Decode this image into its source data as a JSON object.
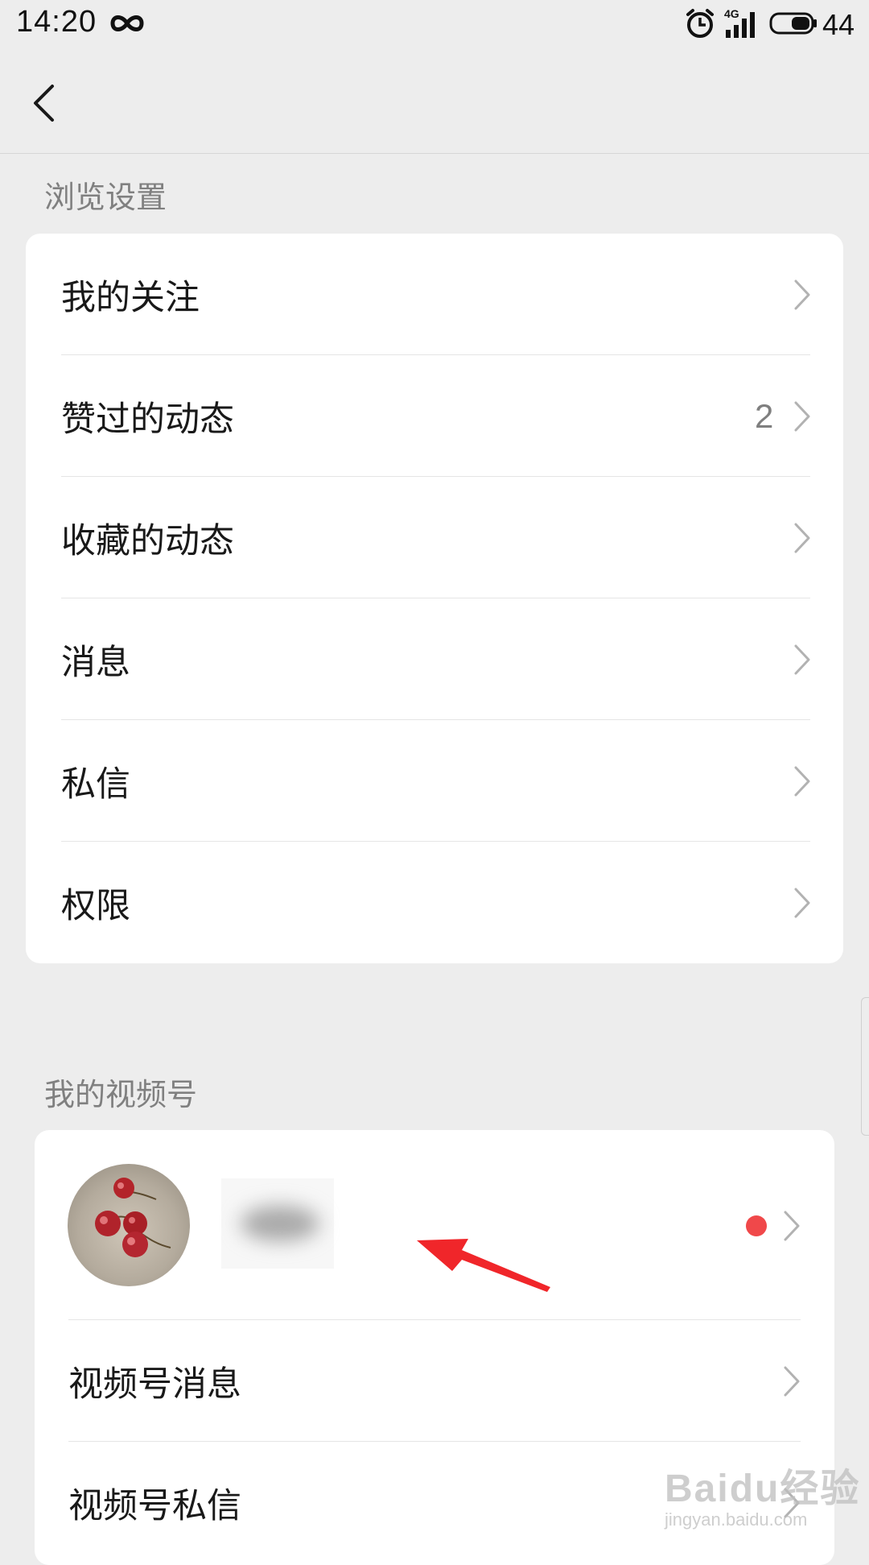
{
  "status_bar": {
    "time": "14:20",
    "infinity_icon": "infinity-icon",
    "alarm_icon": "alarm-icon",
    "network_label": "4G",
    "battery_text": "44"
  },
  "nav": {
    "back_icon": "chevron-left-icon"
  },
  "browse_section": {
    "title": "浏览设置",
    "items": [
      {
        "label": "我的关注"
      },
      {
        "label": "赞过的动态",
        "count": "2"
      },
      {
        "label": "收藏的动态"
      },
      {
        "label": "消息"
      },
      {
        "label": "私信"
      },
      {
        "label": "权限"
      }
    ]
  },
  "channels_section": {
    "title": "我的视频号",
    "profile": {
      "avatar_icon": "cherries-avatar",
      "has_red_dot": true
    },
    "items": [
      {
        "label": "视频号消息"
      },
      {
        "label": "视频号私信"
      }
    ]
  },
  "watermark": {
    "logo": "Baidu经验",
    "url": "jingyan.baidu.com"
  },
  "colors": {
    "background": "#ededed",
    "card": "#ffffff",
    "text": "#191919",
    "secondary_text": "#808080",
    "red_dot": "#f0484a",
    "annotation_arrow": "#f0262a"
  }
}
